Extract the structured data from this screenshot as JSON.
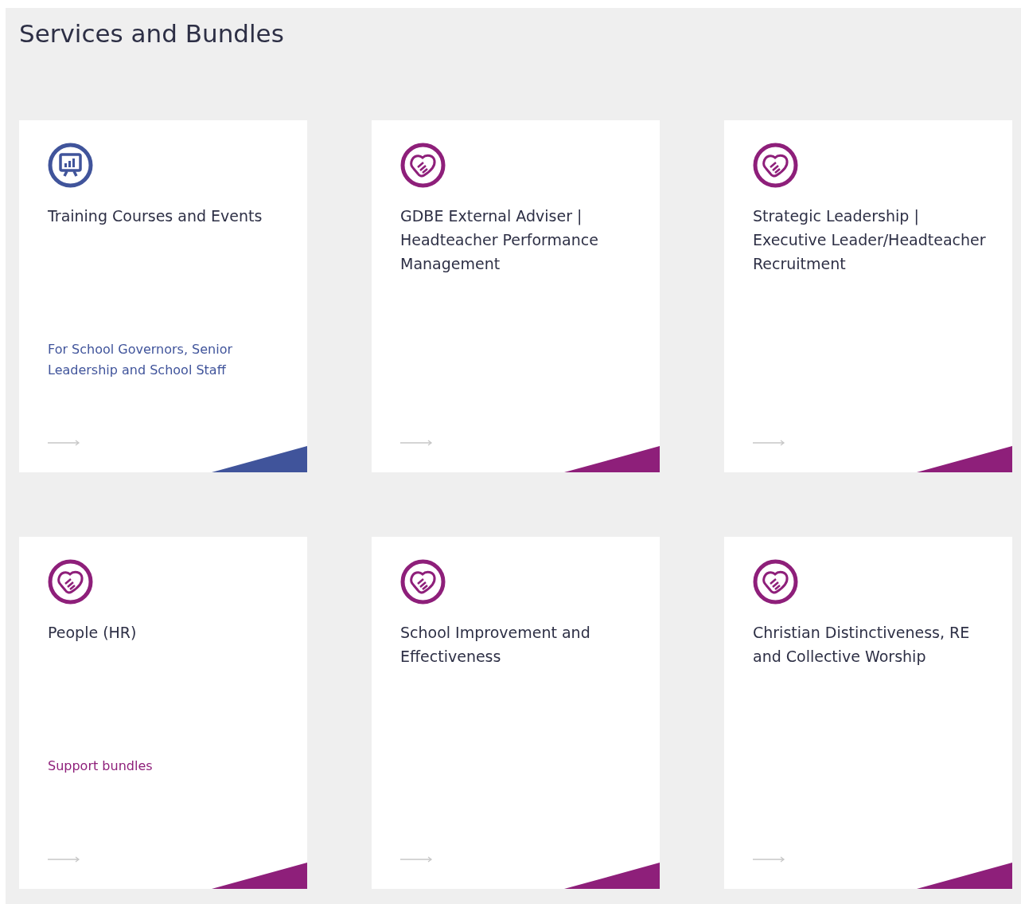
{
  "section": {
    "title": "Services and Bundles"
  },
  "cards": [
    {
      "kind": "presentation",
      "color": "#40549b",
      "title": "Training Courses and Events",
      "subtitle": "For School Governors, Senior Leadership and School Staff"
    },
    {
      "kind": "handshake",
      "color": "#8e1f7a",
      "title": "GDBE External Adviser | Headteacher Performance Management"
    },
    {
      "kind": "handshake",
      "color": "#8e1f7a",
      "title": "Strategic Leadership | Executive Leader/Headteacher Recruitment"
    },
    {
      "kind": "handshake",
      "color": "#8e1f7a",
      "title": "People (HR)",
      "subtitle": "Support bundles"
    },
    {
      "kind": "handshake",
      "color": "#8e1f7a",
      "title": "School Improvement and Effectiveness"
    },
    {
      "kind": "handshake",
      "color": "#8e1f7a",
      "title": "Christian Distinctiveness, RE and Collective Worship"
    }
  ]
}
